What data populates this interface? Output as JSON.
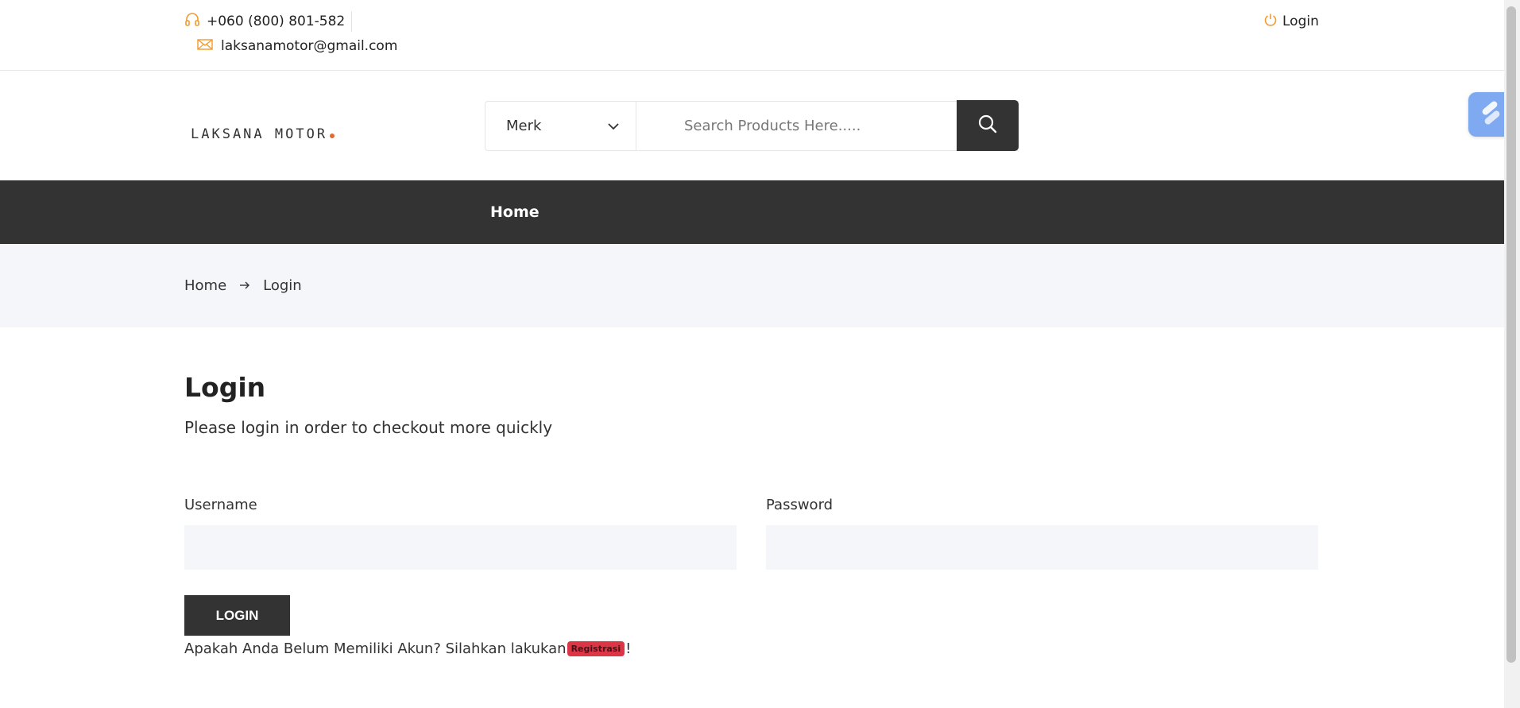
{
  "topbar": {
    "phone": "+060 (800) 801-582",
    "email": "laksanamotor@gmail.com",
    "login_label": "Login"
  },
  "header": {
    "logo_text": "LAKSANA MOTOR",
    "merk_label": "Merk",
    "search_placeholder": "Search Products Here....."
  },
  "nav": {
    "items": [
      {
        "label": "Home"
      }
    ]
  },
  "breadcrumb": {
    "home": "Home",
    "current": "Login"
  },
  "login": {
    "title": "Login",
    "subtitle": "Please login in order to checkout more quickly",
    "username_label": "Username",
    "password_label": "Password",
    "username_value": "",
    "password_value": "",
    "button_label": "LOGIN",
    "register_prefix": "Apakah Anda Belum Memiliki Akun? Silahkan lakukan",
    "register_link": "Registrasi",
    "register_suffix": "!"
  },
  "colors": {
    "accent_orange": "#e36b2c",
    "dark": "#333333",
    "light_bg": "#f5f6f9",
    "danger": "#dc3545",
    "widget_blue": "#7fa9f0"
  },
  "icons": {
    "phone": "headset-icon",
    "email": "envelope-icon",
    "login": "power-icon",
    "dropdown": "chevron-down-icon",
    "search": "search-icon",
    "breadcrumb_separator": "arrow-right-icon",
    "widget": "extension-widget-icon"
  }
}
